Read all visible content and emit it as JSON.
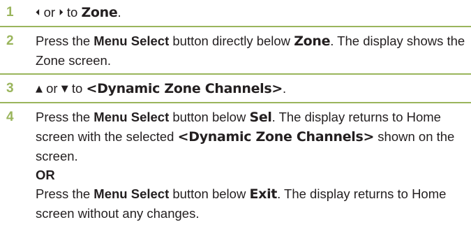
{
  "steps": [
    {
      "number": "1",
      "arrow_left": "⏴",
      "text_or": " or ",
      "arrow_right": "⏵",
      "text_to": " to ",
      "zone_label": "Zone",
      "end": "."
    },
    {
      "number": "2",
      "text_press": "Press the ",
      "menu_select": "Menu Select",
      "text_mid": " button directly below ",
      "zone_label": "Zone",
      "text_end": ". The display shows the Zone screen."
    },
    {
      "number": "3",
      "arrow_up": "▲",
      "text_or": " or ",
      "arrow_down": "▼",
      "text_to": " to ",
      "dyn_label": "<Dynamic Zone Channels>",
      "end": "."
    },
    {
      "number": "4",
      "text_press": "Press the ",
      "menu_select": "Menu Select",
      "text_below": " button below ",
      "sel_label": "Sel",
      "text_mid": ". The display returns to Home screen with the selected ",
      "dyn_label": "<Dynamic Zone Channels>",
      "text_end": " shown on the screen.",
      "or_label": "OR",
      "text_press2": "Press the ",
      "menu_select2": "Menu Select",
      "text_below2": " button below ",
      "exit_label": "Exit",
      "text_end2": ". The display returns to Home screen without any changes."
    }
  ],
  "colors": {
    "accent_green": "#9ab55c",
    "text": "#231f20"
  }
}
